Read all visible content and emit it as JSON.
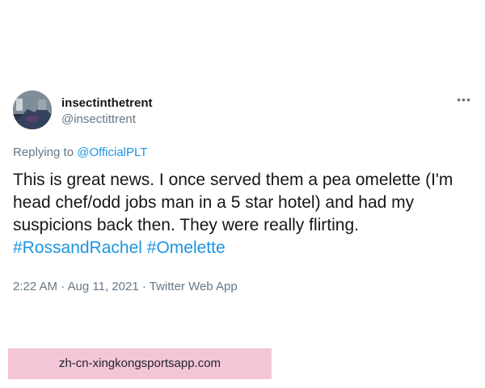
{
  "tweet": {
    "display_name": "insectinthetrent",
    "handle": "@insectittrent",
    "more_icon": "more-horizontal-icon",
    "replying_to_prefix": "Replying to ",
    "replying_to_mention": "@OfficialPLT",
    "body_text": "This is great news. I once served them a pea omelette (I'm head chef/odd jobs man in a 5 star hotel) and had my suspicions back then. They were really flirting.",
    "hashtags": [
      "#RossandRachel",
      "#Omelette"
    ],
    "timestamp": "2:22 AM · Aug 11, 2021 · Twitter Web App"
  },
  "watermark": {
    "text": "zh-cn-xingkongsportsapp.com"
  },
  "colors": {
    "text": "#14171a",
    "secondary": "#657786",
    "link": "#1b95e0",
    "watermark_bg": "#f4c5d6"
  }
}
